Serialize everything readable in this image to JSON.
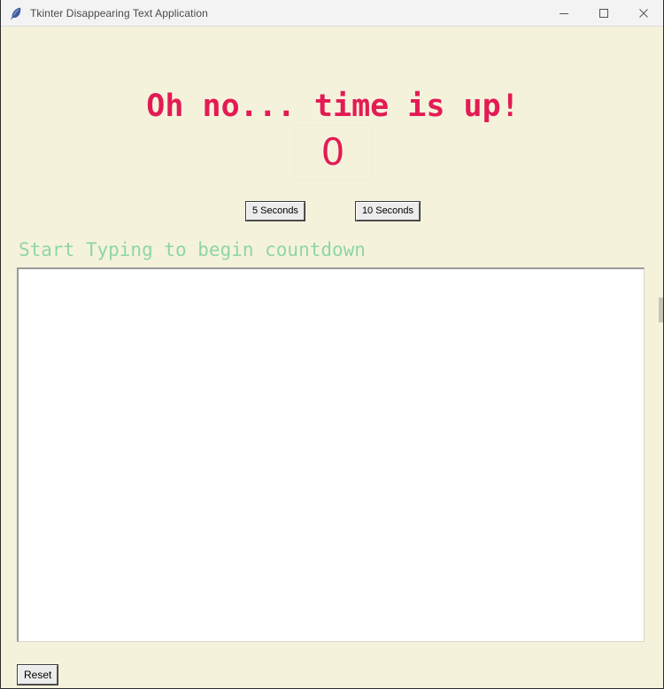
{
  "window": {
    "title": "Tkinter Disappearing Text Application",
    "icon": "tk-feather-icon",
    "background_color": "#f5f2dc",
    "controls": [
      {
        "name": "minimize",
        "glyph": "minimize-icon"
      },
      {
        "name": "maximize",
        "glyph": "maximize-icon"
      },
      {
        "name": "close",
        "glyph": "close-icon"
      }
    ]
  },
  "main": {
    "headline": "Oh no... time is up!",
    "headline_color": "#e31b54",
    "counter_value": "0",
    "counter_color": "#e31b54",
    "prompt": "Start Typing to begin countdown",
    "prompt_color": "#8ed6a4",
    "duration_buttons": [
      {
        "label": "5 Seconds"
      },
      {
        "label": "10 Seconds"
      }
    ],
    "editor": {
      "value": "",
      "placeholder": ""
    },
    "reset_label": "Reset"
  }
}
